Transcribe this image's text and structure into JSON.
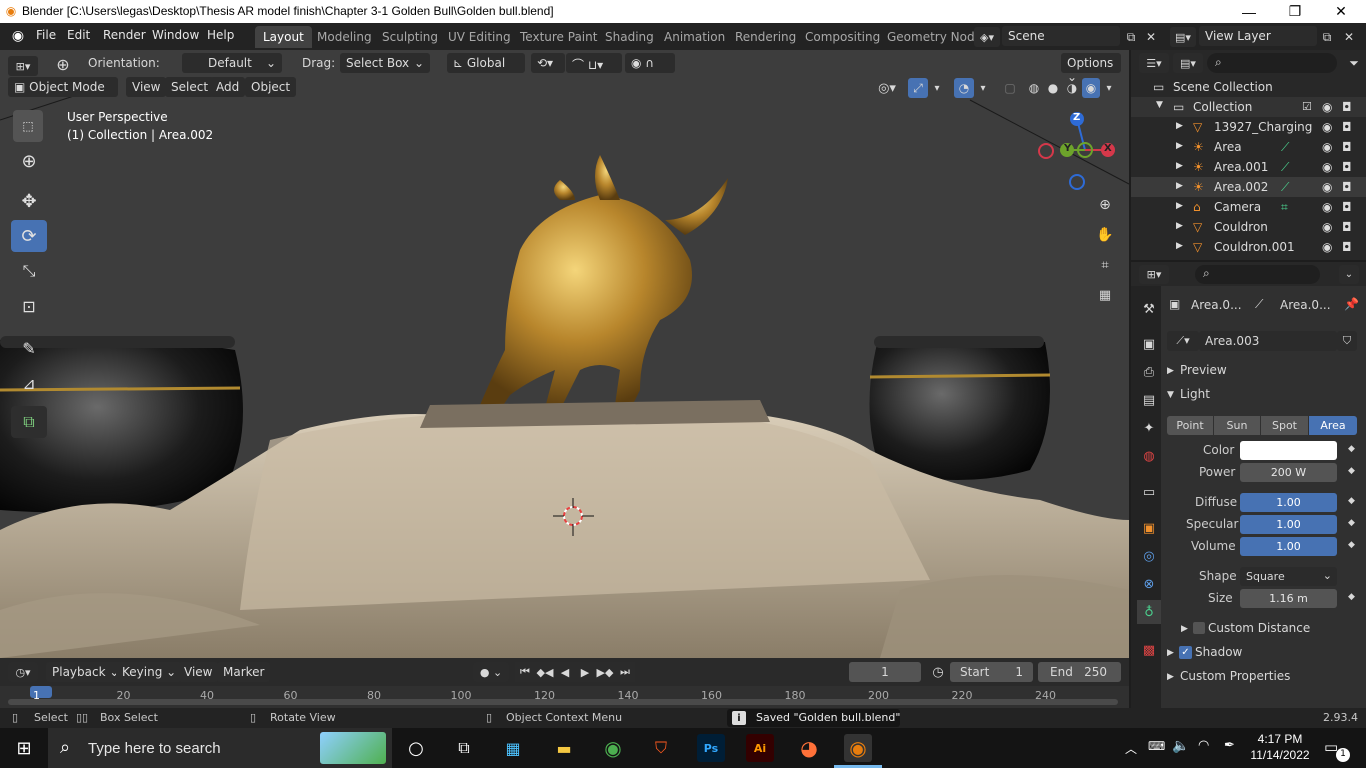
{
  "window": {
    "title": "Blender [C:\\Users\\legas\\Desktop\\Thesis AR model finish\\Chapter 3-1 Golden Bull\\Golden bull.blend]",
    "minimize": "—",
    "maximize": "❐",
    "close": "✕"
  },
  "menu": {
    "file": "File",
    "edit": "Edit",
    "render": "Render",
    "window": "Window",
    "help": "Help"
  },
  "workspaces": [
    "Layout",
    "Modeling",
    "Sculpting",
    "UV Editing",
    "Texture Paint",
    "Shading",
    "Animation",
    "Rendering",
    "Compositing",
    "Geometry Nod"
  ],
  "scene": {
    "name": "Scene",
    "view_layer": "View Layer"
  },
  "tool_header": {
    "orientation_label": "Orientation:",
    "orientation_value": "Default",
    "drag_label": "Drag:",
    "drag_value": "Select Box",
    "transform": "Global",
    "options": "Options"
  },
  "viewport_header": {
    "mode": "Object Mode",
    "view": "View",
    "select": "Select",
    "add": "Add",
    "object": "Object"
  },
  "viewport": {
    "perspective": "User Perspective",
    "collection_info": "(1) Collection | Area.002"
  },
  "gizmo": {
    "x": "X",
    "y": "Y",
    "z": "Z"
  },
  "outliner": {
    "root": "Scene Collection",
    "collection": "Collection",
    "items": [
      {
        "name": "13927_Charging",
        "type": "mesh"
      },
      {
        "name": "Area",
        "type": "light"
      },
      {
        "name": "Area.001",
        "type": "light"
      },
      {
        "name": "Area.002",
        "type": "light"
      },
      {
        "name": "Camera",
        "type": "camera"
      },
      {
        "name": "Couldron",
        "type": "mesh"
      },
      {
        "name": "Couldron.001",
        "type": "mesh"
      }
    ]
  },
  "properties": {
    "breadcrumb_object": "Area.0...",
    "breadcrumb_data": "Area.0...",
    "datablock": "Area.003",
    "panels": {
      "preview": "Preview",
      "light": "Light",
      "custom_distance": "Custom Distance",
      "shadow": "Shadow",
      "custom_properties": "Custom Properties"
    },
    "light_types": [
      "Point",
      "Sun",
      "Spot",
      "Area"
    ],
    "active_light_type": "Area",
    "color_label": "Color",
    "power_label": "Power",
    "power_value": "200 W",
    "diffuse_label": "Diffuse",
    "diffuse_value": "1.00",
    "specular_label": "Specular",
    "specular_value": "1.00",
    "volume_label": "Volume",
    "volume_value": "1.00",
    "shape_label": "Shape",
    "shape_value": "Square",
    "size_label": "Size",
    "size_value": "1.16 m",
    "light_color": "#ffffff",
    "accent": "#4772b3"
  },
  "timeline": {
    "playback": "Playback",
    "keying": "Keying",
    "view": "View",
    "marker": "Marker",
    "current_frame": "1",
    "start_label": "Start",
    "start_value": "1",
    "end_label": "End",
    "end_value": "250",
    "ticks": [
      "1",
      "20",
      "40",
      "60",
      "80",
      "100",
      "120",
      "140",
      "160",
      "180",
      "200",
      "220",
      "240"
    ]
  },
  "statusbar": {
    "select": "Select",
    "box_select": "Box Select",
    "rotate": "Rotate View",
    "context": "Object Context Menu",
    "message": "Saved \"Golden bull.blend\"",
    "version": "2.93.4"
  },
  "taskbar": {
    "search_placeholder": "Type here to search",
    "time": "4:17 PM",
    "date": "11/14/2022",
    "notifications": "1"
  }
}
